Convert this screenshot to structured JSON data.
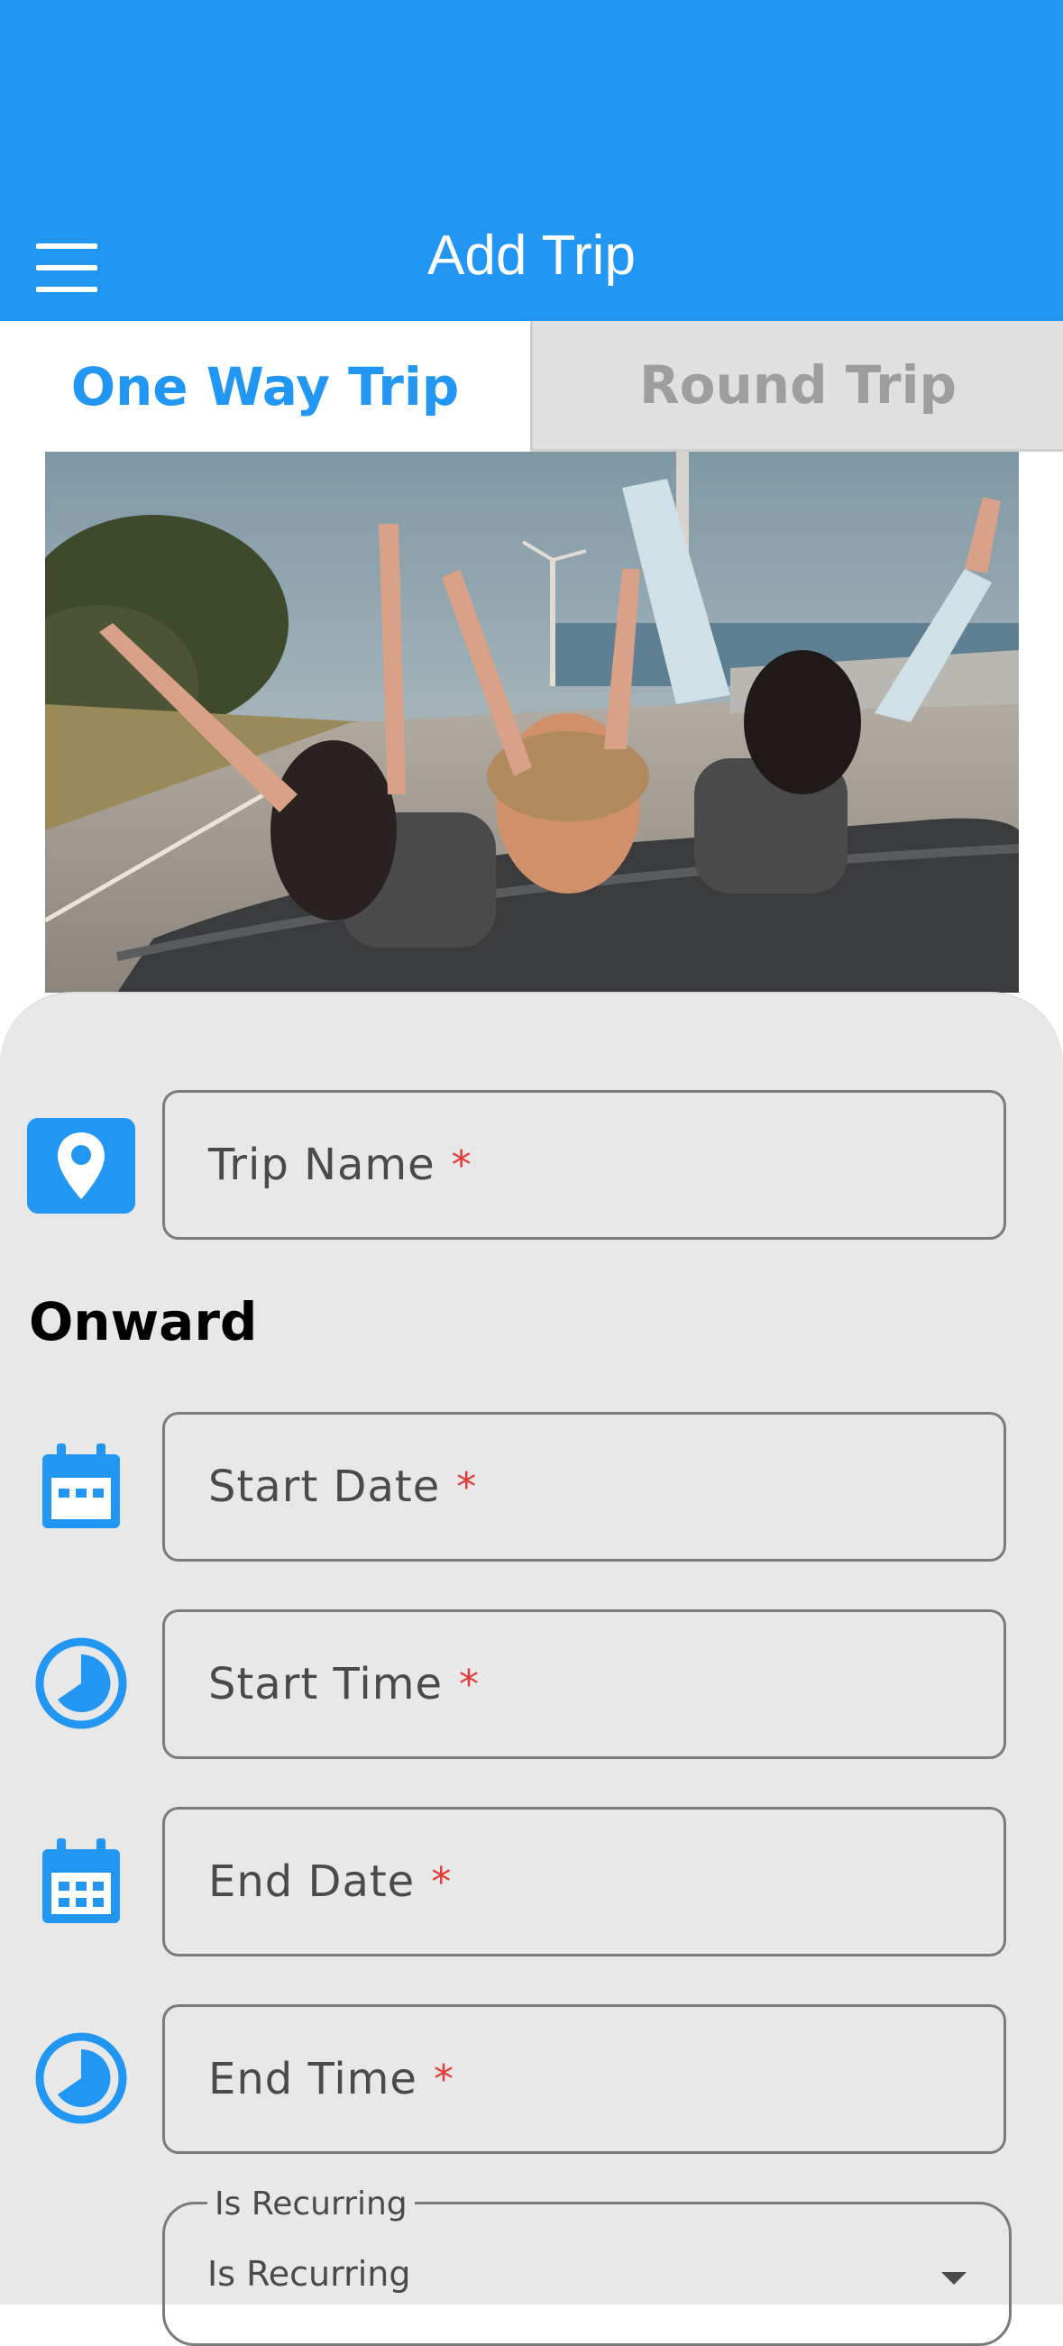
{
  "app_bar": {
    "title": "Add Trip",
    "menu_icon": "hamburger-menu-icon",
    "background_color": "#2196f3"
  },
  "tabs": [
    {
      "label": "One Way Trip",
      "active": true
    },
    {
      "label": "Round Trip",
      "active": false
    }
  ],
  "hero_image": {
    "description_icon": "photo"
  },
  "form": {
    "trip_name": {
      "label": "Trip Name",
      "required_mark": "*",
      "icon": "location-pin-icon"
    },
    "section_title": "Onward",
    "start_date": {
      "label": "Start Date",
      "required_mark": "*",
      "icon": "calendar-icon"
    },
    "start_time": {
      "label": "Start Time",
      "required_mark": "*",
      "icon": "clock-icon"
    },
    "end_date": {
      "label": "End Date",
      "required_mark": "*",
      "icon": "calendar-icon"
    },
    "end_time": {
      "label": "End Time",
      "required_mark": "*",
      "icon": "clock-icon"
    },
    "is_recurring": {
      "label": "Is Recurring",
      "value": "Is Recurring",
      "icon": "dropdown-arrow-icon"
    }
  },
  "colors": {
    "accent": "#2196f3",
    "form_background": "#e8e8e9",
    "required": "#e53935",
    "tab_inactive_text": "#9e9e9e",
    "tab_inactive_bg": "#e0e0e0"
  }
}
